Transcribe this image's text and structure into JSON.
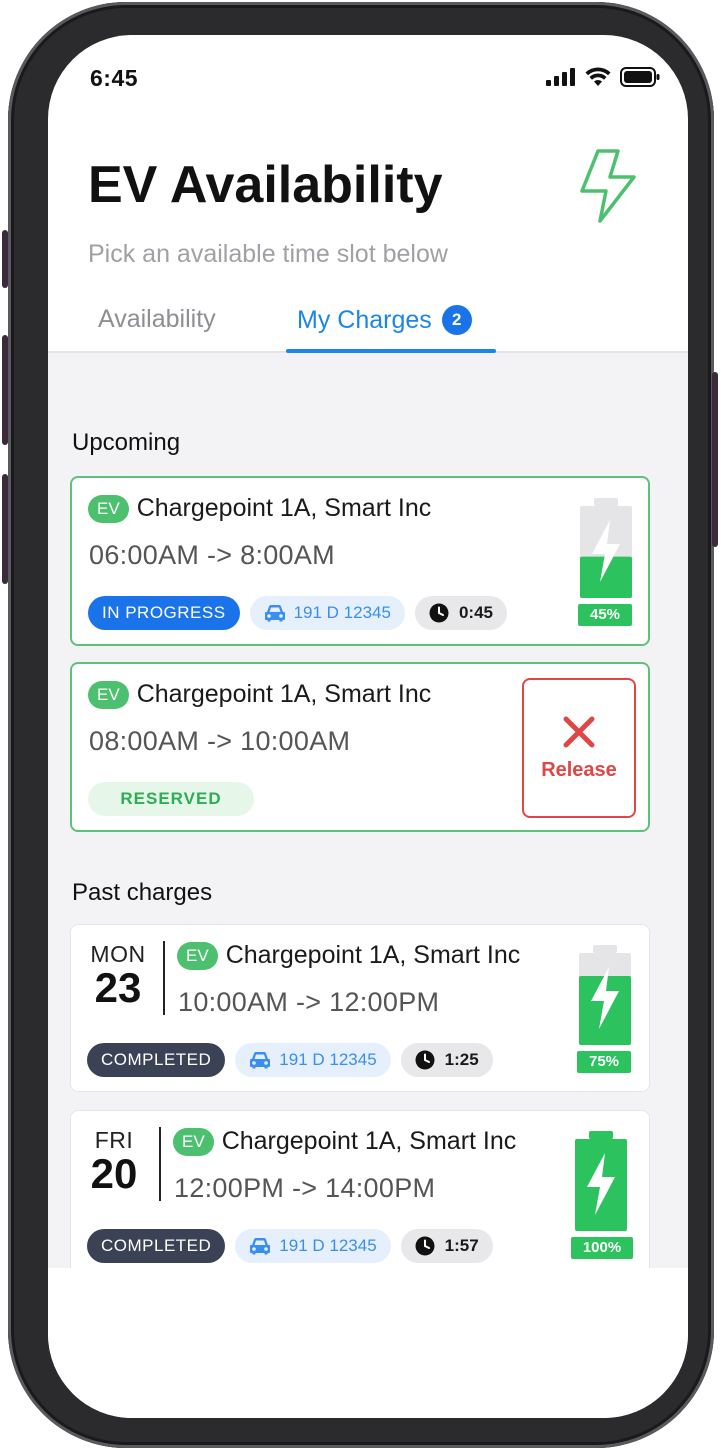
{
  "status_bar": {
    "time": "6:45"
  },
  "header": {
    "title": "EV Availability",
    "subtitle": "Pick an available time slot below"
  },
  "tabs": {
    "availability_label": "Availability",
    "my_charges_label": "My Charges",
    "my_charges_count": "2"
  },
  "upcoming": {
    "section_title": "Upcoming",
    "items": [
      {
        "ev_label": "EV",
        "name": "Chargepoint 1A, Smart Inc",
        "time_range": "06:00AM -> 8:00AM",
        "status": "IN PROGRESS",
        "plate": "191 D 12345",
        "duration": "0:45",
        "battery_percent_label": "45%",
        "battery_fraction": 0.45
      },
      {
        "ev_label": "EV",
        "name": "Chargepoint 1A, Smart Inc",
        "time_range": "08:00AM -> 10:00AM",
        "status": "RESERVED",
        "release_label": "Release"
      }
    ]
  },
  "past": {
    "section_title": "Past charges",
    "items": [
      {
        "day_of_week": "MON",
        "day": "23",
        "ev_label": "EV",
        "name": "Chargepoint 1A, Smart Inc",
        "time_range": "10:00AM -> 12:00PM",
        "status": "COMPLETED",
        "plate": "191 D 12345",
        "duration": "1:25",
        "battery_percent_label": "75%",
        "battery_fraction": 0.75
      },
      {
        "day_of_week": "FRI",
        "day": "20",
        "ev_label": "EV",
        "name": "Chargepoint 1A, Smart Inc",
        "time_range": "12:00PM -> 14:00PM",
        "status": "COMPLETED",
        "plate": "191 D 12345",
        "duration": "1:57",
        "battery_percent_label": "100%",
        "battery_fraction": 1.0
      }
    ]
  },
  "colors": {
    "accent_blue": "#1a86e8",
    "ev_green": "#4cc06e",
    "battery_green": "#2cc25e",
    "release_red": "#e04646",
    "completed_dark": "#3c4255"
  }
}
